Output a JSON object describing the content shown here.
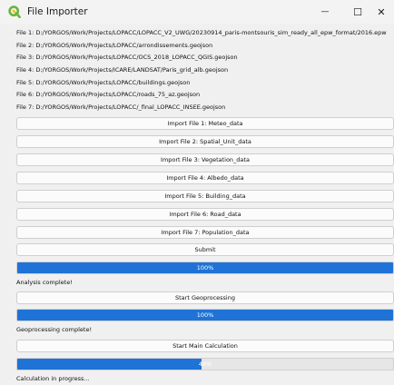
{
  "window": {
    "title": "File Importer",
    "minimize_glyph": "—",
    "maximize_glyph": "☐",
    "close_glyph": "✕"
  },
  "files": [
    "File 1: D:/YORGOS/Work/Projects/LOPACC/LOPACC_V2_UWG/20230914_paris-montsouris_sim_ready_all_epw_format/2016.epw",
    "File 2: D:/YORGOS/Work/Projects/LOPACC/arrondissements.geojson",
    "File 3: D:/YORGOS/Work/Projects/LOPACC/OCS_2018_LOPACC_QGIS.geojson",
    "File 4: D:/YORGOS/Work/Projects/ICARE/LANDSAT/Paris_grid_alb.geojson",
    "File 5: D:/YORGOS/Work/Projects/LOPACC/buildings.geojson",
    "File 6: D:/YORGOS/Work/Projects/LOPACC/roads_75_az.geojson",
    "File 7: D:/YORGOS/Work/Projects/LOPACC/_final_LOPACC_INSEE.geojson"
  ],
  "import_buttons": [
    "Import File 1: Meteo_data",
    "Import File 2: Spatial_Unit_data",
    "Import File 3: Vegetation_data",
    "Import File 4: Albedo_data",
    "Import File 5: Building_data",
    "Import File 6: Road_data",
    "Import File 7: Population_data"
  ],
  "submit_label": "Submit",
  "progress1": {
    "value": 100,
    "label": "100%"
  },
  "status1": "Analysis complete!",
  "geoprocessing_label": "Start Geoprocessing",
  "progress2": {
    "value": 100,
    "label": "100%"
  },
  "status2": "Geoprocessing complete!",
  "main_calc_label": "Start Main Calculation",
  "progress3": {
    "value": 49,
    "label": "49%"
  },
  "status3": "Calculation in progress...",
  "colors": {
    "progress_fill": "#1f73d6",
    "qgis_green": "#6cb33f"
  },
  "icons": {
    "app": "qgis-logo-icon"
  }
}
